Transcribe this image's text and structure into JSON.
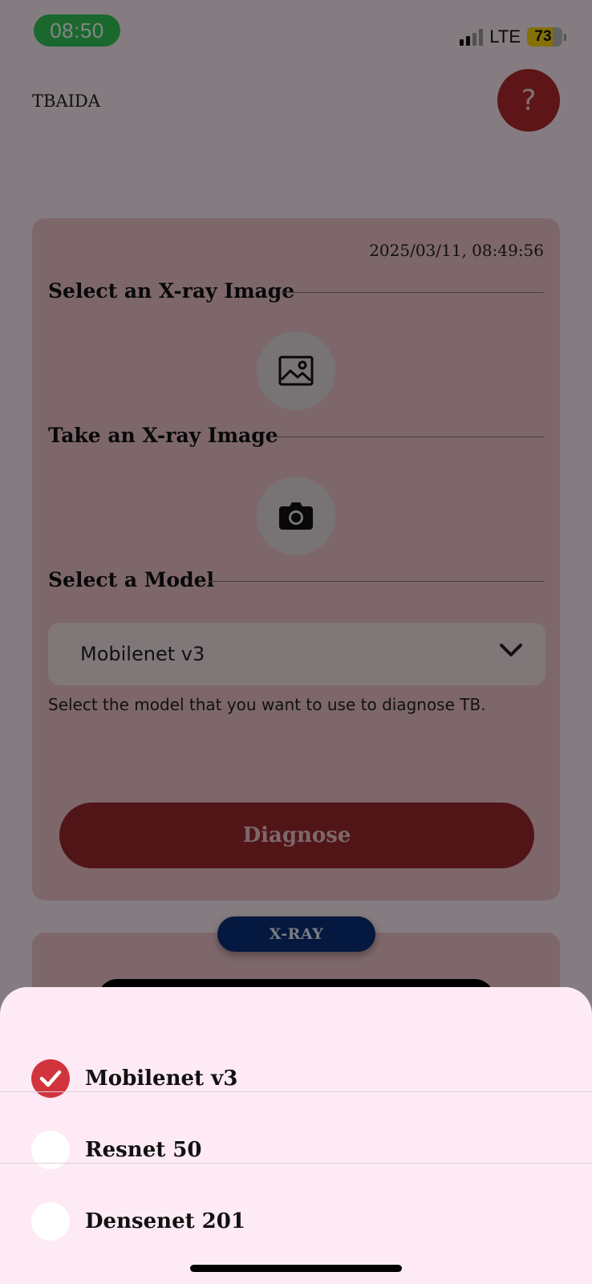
{
  "status_bar": {
    "time": "08:50",
    "network": "LTE",
    "battery_level": "73",
    "battery_fraction": 0.73,
    "time_pill_color": "#34c759"
  },
  "app": {
    "title": "TBAIDA",
    "help_symbol": "?"
  },
  "card": {
    "timestamp": "2025/03/11, 08:49:56",
    "select_image_title": "Select an X-ray Image",
    "take_image_title": "Take an X-ray Image",
    "select_model_title": "Select a Model",
    "selected_model": "Mobilenet v3",
    "helper_text": "Select the model that you want to use to diagnose TB.",
    "diagnose_label": "Diagnose"
  },
  "tab": {
    "label": "X-RAY"
  },
  "sheet": {
    "options": [
      {
        "label": "Mobilenet v3",
        "checked": true
      },
      {
        "label": "Resnet 50",
        "checked": false
      },
      {
        "label": "Densenet 201",
        "checked": false
      }
    ]
  },
  "colors": {
    "accent_red": "#d2343d",
    "button_red": "#9b2a2f",
    "tab_blue": "#0b2f7a",
    "sheet_bg": "#fdeaf4"
  },
  "icons": {
    "image_picker": "image-icon",
    "camera": "camera-icon",
    "dropdown": "chevron-down-icon",
    "check": "checkmark-icon"
  }
}
